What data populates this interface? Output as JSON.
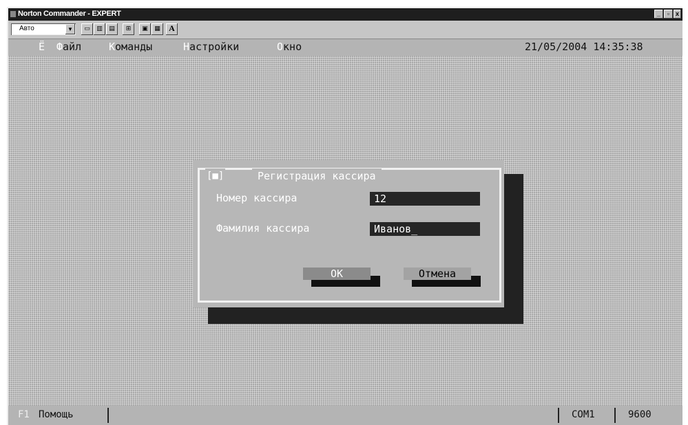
{
  "window": {
    "title": "Norton Commander - EXPERT",
    "buttons": [
      "_",
      "▫",
      "x"
    ]
  },
  "toolbar": {
    "font_select": "Авто",
    "buttons": [
      "▭",
      "▥",
      "▤",
      "⊞",
      "▣",
      "▦",
      "A"
    ]
  },
  "menubar": {
    "items": [
      {
        "hot": "Ё",
        "rest": ""
      },
      {
        "hot": "Ф",
        "rest": "айл"
      },
      {
        "hot": "К",
        "rest": "оманды"
      },
      {
        "hot": "Н",
        "rest": "астройки"
      },
      {
        "hot": "О",
        "rest": "кно"
      }
    ],
    "datetime": "21/05/2004 14:35:38"
  },
  "dialog": {
    "close": "[■]",
    "title": "Регистрация кассира",
    "fields": [
      {
        "hot": "Н",
        "label": "омер кассира",
        "value": "12"
      },
      {
        "hot": "",
        "label": "Фамилия кассира",
        "value": "Иванов_"
      }
    ],
    "ok_label": "OK",
    "cancel_label": "Отмена"
  },
  "statusbar": {
    "f1_key": "F1",
    "f1_label": "Помощь",
    "port": "COM1",
    "baud": "9600"
  },
  "colors": {
    "screen_bg": "#a9a9a9",
    "menubar_bg": "#b4b4b4",
    "field_bg": "#262626",
    "dialog_frame": "#f1f1f1"
  }
}
